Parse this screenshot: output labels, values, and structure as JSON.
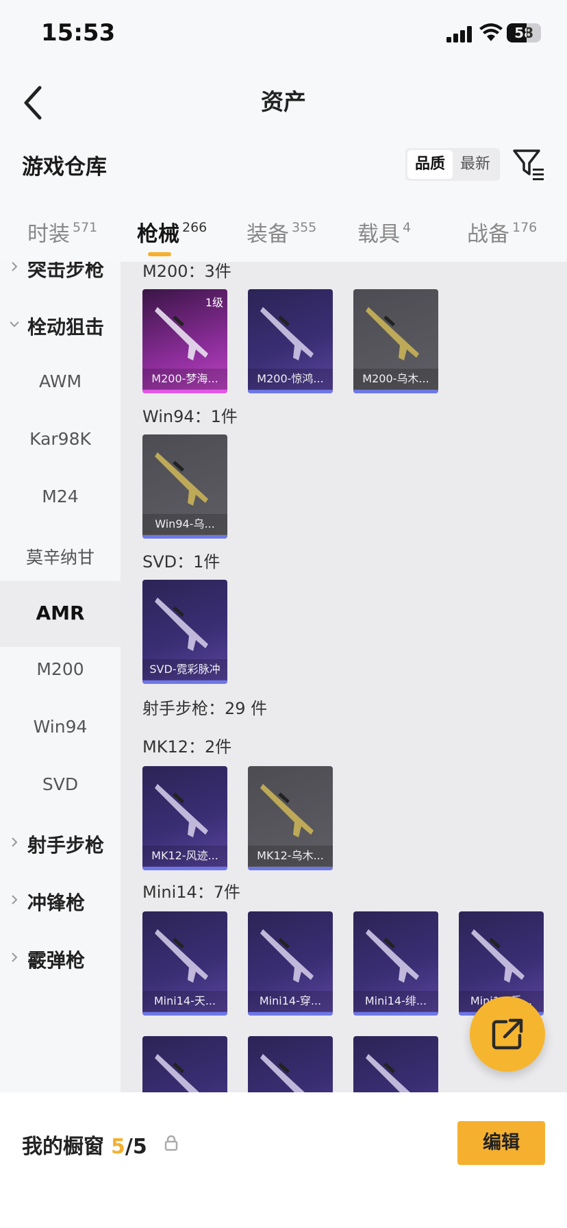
{
  "status_bar": {
    "time": "15:53",
    "battery": "58",
    "battery_level": 0.58
  },
  "nav": {
    "title": "资产"
  },
  "warehouse": {
    "title": "游戏仓库",
    "sort_options": [
      "品质",
      "最新"
    ],
    "active_sort": "品质"
  },
  "tabs": [
    {
      "label": "时装",
      "count": "571"
    },
    {
      "label": "枪械",
      "count": "266"
    },
    {
      "label": "装备",
      "count": "355"
    },
    {
      "label": "载具",
      "count": "4"
    },
    {
      "label": "战备",
      "count": "176"
    }
  ],
  "active_tab": "枪械",
  "sidebar": [
    {
      "label": "突击步枪",
      "type": "group",
      "expanded": false
    },
    {
      "label": "栓动狙击",
      "type": "group",
      "expanded": true
    },
    {
      "label": "AWM",
      "type": "sub"
    },
    {
      "label": "Kar98K",
      "type": "sub"
    },
    {
      "label": "M24",
      "type": "sub"
    },
    {
      "label": "莫辛纳甘",
      "type": "sub"
    },
    {
      "label": "AMR",
      "type": "sub",
      "selected": true
    },
    {
      "label": "M200",
      "type": "sub"
    },
    {
      "label": "Win94",
      "type": "sub"
    },
    {
      "label": "SVD",
      "type": "sub"
    },
    {
      "label": "射手步枪",
      "type": "group",
      "expanded": false
    },
    {
      "label": "冲锋枪",
      "type": "group",
      "expanded": false
    },
    {
      "label": "霰弹枪",
      "type": "group",
      "expanded": false
    }
  ],
  "sections": [
    {
      "title": "M200：3件",
      "items": [
        {
          "name": "M200-梦海...",
          "rarity": "magenta",
          "level": "1级"
        },
        {
          "name": "M200-惊鸿...",
          "rarity": "purple"
        },
        {
          "name": "M200-乌木...",
          "rarity": "gray"
        }
      ]
    },
    {
      "title": "Win94：1件",
      "items": [
        {
          "name": "Win94-乌...",
          "rarity": "gray"
        }
      ]
    },
    {
      "title": "SVD：1件",
      "items": [
        {
          "name": "SVD-霓彩脉冲",
          "rarity": "purple"
        }
      ]
    },
    {
      "title": "射手步枪：29 件",
      "items": []
    },
    {
      "title": "MK12：2件",
      "items": [
        {
          "name": "MK12-风迹...",
          "rarity": "purple"
        },
        {
          "name": "MK12-乌木...",
          "rarity": "gray"
        }
      ]
    },
    {
      "title": "Mini14：7件",
      "items": [
        {
          "name": "Mini14-天...",
          "rarity": "purple"
        },
        {
          "name": "Mini14-穿...",
          "rarity": "purple"
        },
        {
          "name": "Mini14-绯...",
          "rarity": "purple"
        },
        {
          "name": "Mini14-乐...",
          "rarity": "purple"
        },
        {
          "name": "",
          "rarity": "purple"
        },
        {
          "name": "",
          "rarity": "purple"
        },
        {
          "name": "",
          "rarity": "purple"
        }
      ]
    }
  ],
  "bottom": {
    "label": "我的橱窗",
    "current": "5",
    "total": "/5",
    "edit_label": "编辑"
  }
}
